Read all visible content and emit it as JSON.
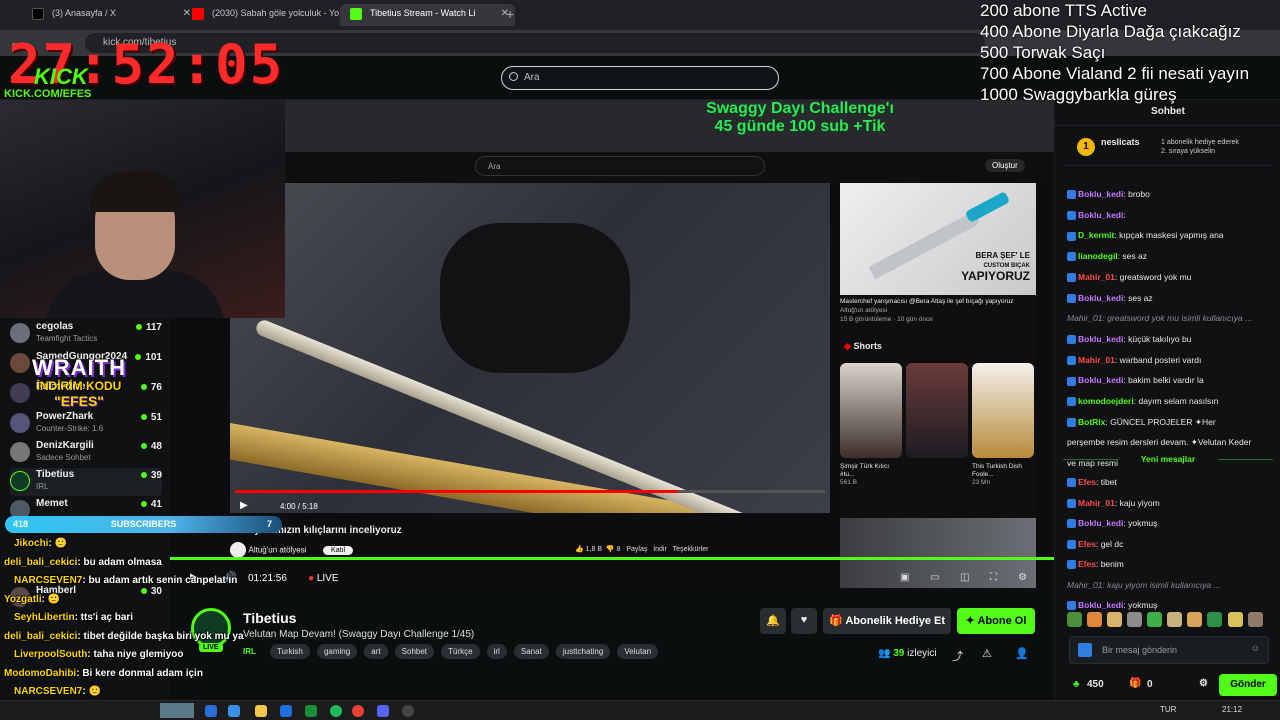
{
  "browser": {
    "tabs": [
      {
        "label": "(3) Anasayfa / X",
        "color": "#000000"
      },
      {
        "label": "(2030) Sabah göle yolculuk - Yo",
        "color": "#ff0000"
      },
      {
        "label": "Tibetius Stream - Watch Li",
        "color": "#53fc18"
      }
    ],
    "new_tab": "+",
    "url": "kick.com/tibetius"
  },
  "kick_header": {
    "search_placeholder": "Ara"
  },
  "overlay": {
    "goals": [
      "200 abone TTS Active",
      "400 Abone Diyarla Dağa çıakcağız",
      "500 Torwak Saçı",
      "700 Abone Vialand 2 fii nesati yayın",
      "1000 Swaggybarkla güreş"
    ],
    "timer": "27:52:05",
    "kick_logo": "KICK",
    "kick_url": "KICK.COM/EFES",
    "wraith": "WRAITH",
    "wraith_code_label": "İNDİRİM KODU",
    "wraith_code": "\"EFES\"",
    "challenge_title": "Swaggy Dayı Challenge'ı",
    "challenge_sub": "45 günde 100 sub +Tik",
    "subbar": {
      "left": "418",
      "label": "SUBSCRIBERS",
      "right": "7"
    }
  },
  "sidebar": {
    "channels": [
      {
        "name": "cegolas",
        "category": "Teamfight Tactics",
        "viewers": "117"
      },
      {
        "name": "SamedGungor2024",
        "category": "",
        "viewers": "101"
      },
      {
        "name": "Falconbee",
        "category": "",
        "viewers": "76"
      },
      {
        "name": "PowerZhark",
        "category": "Counter-Strike: 1.6",
        "viewers": "51"
      },
      {
        "name": "DenizKargili",
        "category": "Sadece Sohbet",
        "viewers": "48"
      },
      {
        "name": "Tibetius",
        "category": "IRL",
        "viewers": "39"
      },
      {
        "name": "Memet",
        "category": "",
        "viewers": "41"
      },
      {
        "name": "Hamberl",
        "category": "",
        "viewers": "30"
      }
    ]
  },
  "youtube": {
    "search_placeholder": "Ara",
    "create_label": "Oluştur",
    "time": "4:00 / 5:18",
    "video_title": "Subaylarımızın kılıçlarını inceliyoruz",
    "channel": "Altuğ'un atölyesi",
    "join": "Katıl",
    "likes": "1,8 B",
    "dislikes": "8",
    "share": "Paylaş",
    "download": "İndir",
    "thanks": "Teşekkürler",
    "side_video_title": "Masterchef yarışmacısı @Bera Altaş  ile şef bıçağı yapıyoruz",
    "side_video_channel": "Altuğ'un atölyesi",
    "side_video_meta": "15 B görüntüleme · 10 gün önce",
    "side_thumb_text": "BERA ŞEF' LE",
    "side_thumb_text2": "CUSTOM BIÇAK",
    "side_thumb_text3": "YAPIYORUZ",
    "shorts_label": "Shorts",
    "short1": "Şimşir Türk Kılıcı #tu...",
    "short1_views": "561 B",
    "short3": "This Turkish Dish Foole...",
    "short3_views": "23 Mn"
  },
  "player": {
    "elapsed": "01:21:56",
    "live": "LIVE"
  },
  "stream": {
    "streamer": "Tibetius",
    "title": "Velutan Map Devam! (Swaggy Dayı Challenge 1/45)",
    "category": "IRL",
    "tags": [
      "Turkish",
      "gaming",
      "art",
      "Sohbet",
      "Türkçe",
      "irl",
      "Sanat",
      "justtchating",
      "Velutan"
    ],
    "live_badge": "LIVE",
    "gift_button": "Abonelik Hediye Et",
    "subscribe_button": "Abone Ol",
    "viewers": "39",
    "viewers_label": "izleyici"
  },
  "chat": {
    "header": "Sohbet",
    "pinned_user": "neslicats",
    "pinned_rank": "1",
    "pinned_text": "1 abonelik hediye ederek",
    "pinned_text2": "2. sıraya yükselin",
    "messages": [
      {
        "user": "Boklu_kedi",
        "text": "brobo",
        "color": "#c678ff"
      },
      {
        "user": "Boklu_kedi",
        "text": "",
        "color": "#c678ff"
      },
      {
        "user": "D_kermit",
        "text": "kıpçak maskesi yapmış ana",
        "color": "#53fc18"
      },
      {
        "user": "lianodegil",
        "text": "ses az",
        "color": "#53fc18"
      },
      {
        "user": "Mahir_01",
        "text": "greatsword yok mu",
        "color": "#ff4b4b"
      },
      {
        "user": "Boklu_kedi",
        "text": "ses az",
        "color": "#c678ff"
      },
      {
        "user": "",
        "text": "Mahir_01: greatsword yok mu isimli kullanıcıya ...",
        "color": "#8a8d91"
      },
      {
        "user": "Boklu_kedi",
        "text": "küçük takılıyo bu",
        "color": "#c678ff"
      },
      {
        "user": "Mahir_01",
        "text": "warband posteri vardı",
        "color": "#ff4b4b"
      },
      {
        "user": "Boklu_kedi",
        "text": "bakim belki vardır la",
        "color": "#c678ff"
      },
      {
        "user": "komodoejderi",
        "text": "dayım selam nasılsın",
        "color": "#53fc18"
      },
      {
        "user": "BotRix",
        "text": "GÜNCEL PROJELER ✦Her",
        "color": "#53fc18"
      },
      {
        "user": "",
        "text": "perşembe resim dersleri devam. ✦Velutan Keder",
        "color": "#e8e8e8"
      },
      {
        "user": "",
        "text": "ve map resmi",
        "color": "#e8e8e8"
      }
    ],
    "new_messages_label": "Yeni mesajlar",
    "new_messages": [
      {
        "user": "Efes",
        "text": "tibet",
        "color": "#ff4b4b"
      },
      {
        "user": "Mahir_01",
        "text": "kaju yiyom",
        "color": "#ff4b4b"
      },
      {
        "user": "Boklu_kedi",
        "text": "yokmuş",
        "color": "#c678ff"
      },
      {
        "user": "Efes",
        "text": "gel dc",
        "color": "#ff4b4b"
      },
      {
        "user": "Efes",
        "text": "benim",
        "color": "#ff4b4b"
      },
      {
        "user": "",
        "text": "Mahir_01: kaju yiyom      isimli kullanıcıya ...",
        "color": "#8a8d91"
      },
      {
        "user": "Boklu_kedi",
        "text": "yokmuş",
        "color": "#c678ff"
      }
    ],
    "input_placeholder": "Bir mesaj gönderin",
    "points": "450",
    "gifts": "0",
    "send_button": "Gönder"
  },
  "overlay_chat": [
    {
      "user": "Jikochi",
      "text": ": 🙂"
    },
    {
      "user": "deli_bali_cekici",
      "text": ": bu adam olmasa"
    },
    {
      "user": "NARCSEVEN7",
      "text": ": bu adam artık senin canpelat ın"
    },
    {
      "user": "Yozgatli",
      "text": ": 🙂"
    },
    {
      "user": "SeyhLibertin",
      "text": ": tts'i aç bari"
    },
    {
      "user": "deli_bali_cekici",
      "text": ": tibet değilde başka biri yok mu ya"
    },
    {
      "user": "LiverpoolSouth",
      "text": ": taha niye glemiyoo"
    },
    {
      "user": "ModomoDahibi",
      "text": ": Bi kere donmal adam için"
    },
    {
      "user": "NARCSEVEN7",
      "text": ": 🙂"
    },
    {
      "user": "deli_bali_cekici",
      "text": ": tts aç"
    }
  ],
  "taskbar": {
    "time": "21:12",
    "lang": "TUR"
  }
}
